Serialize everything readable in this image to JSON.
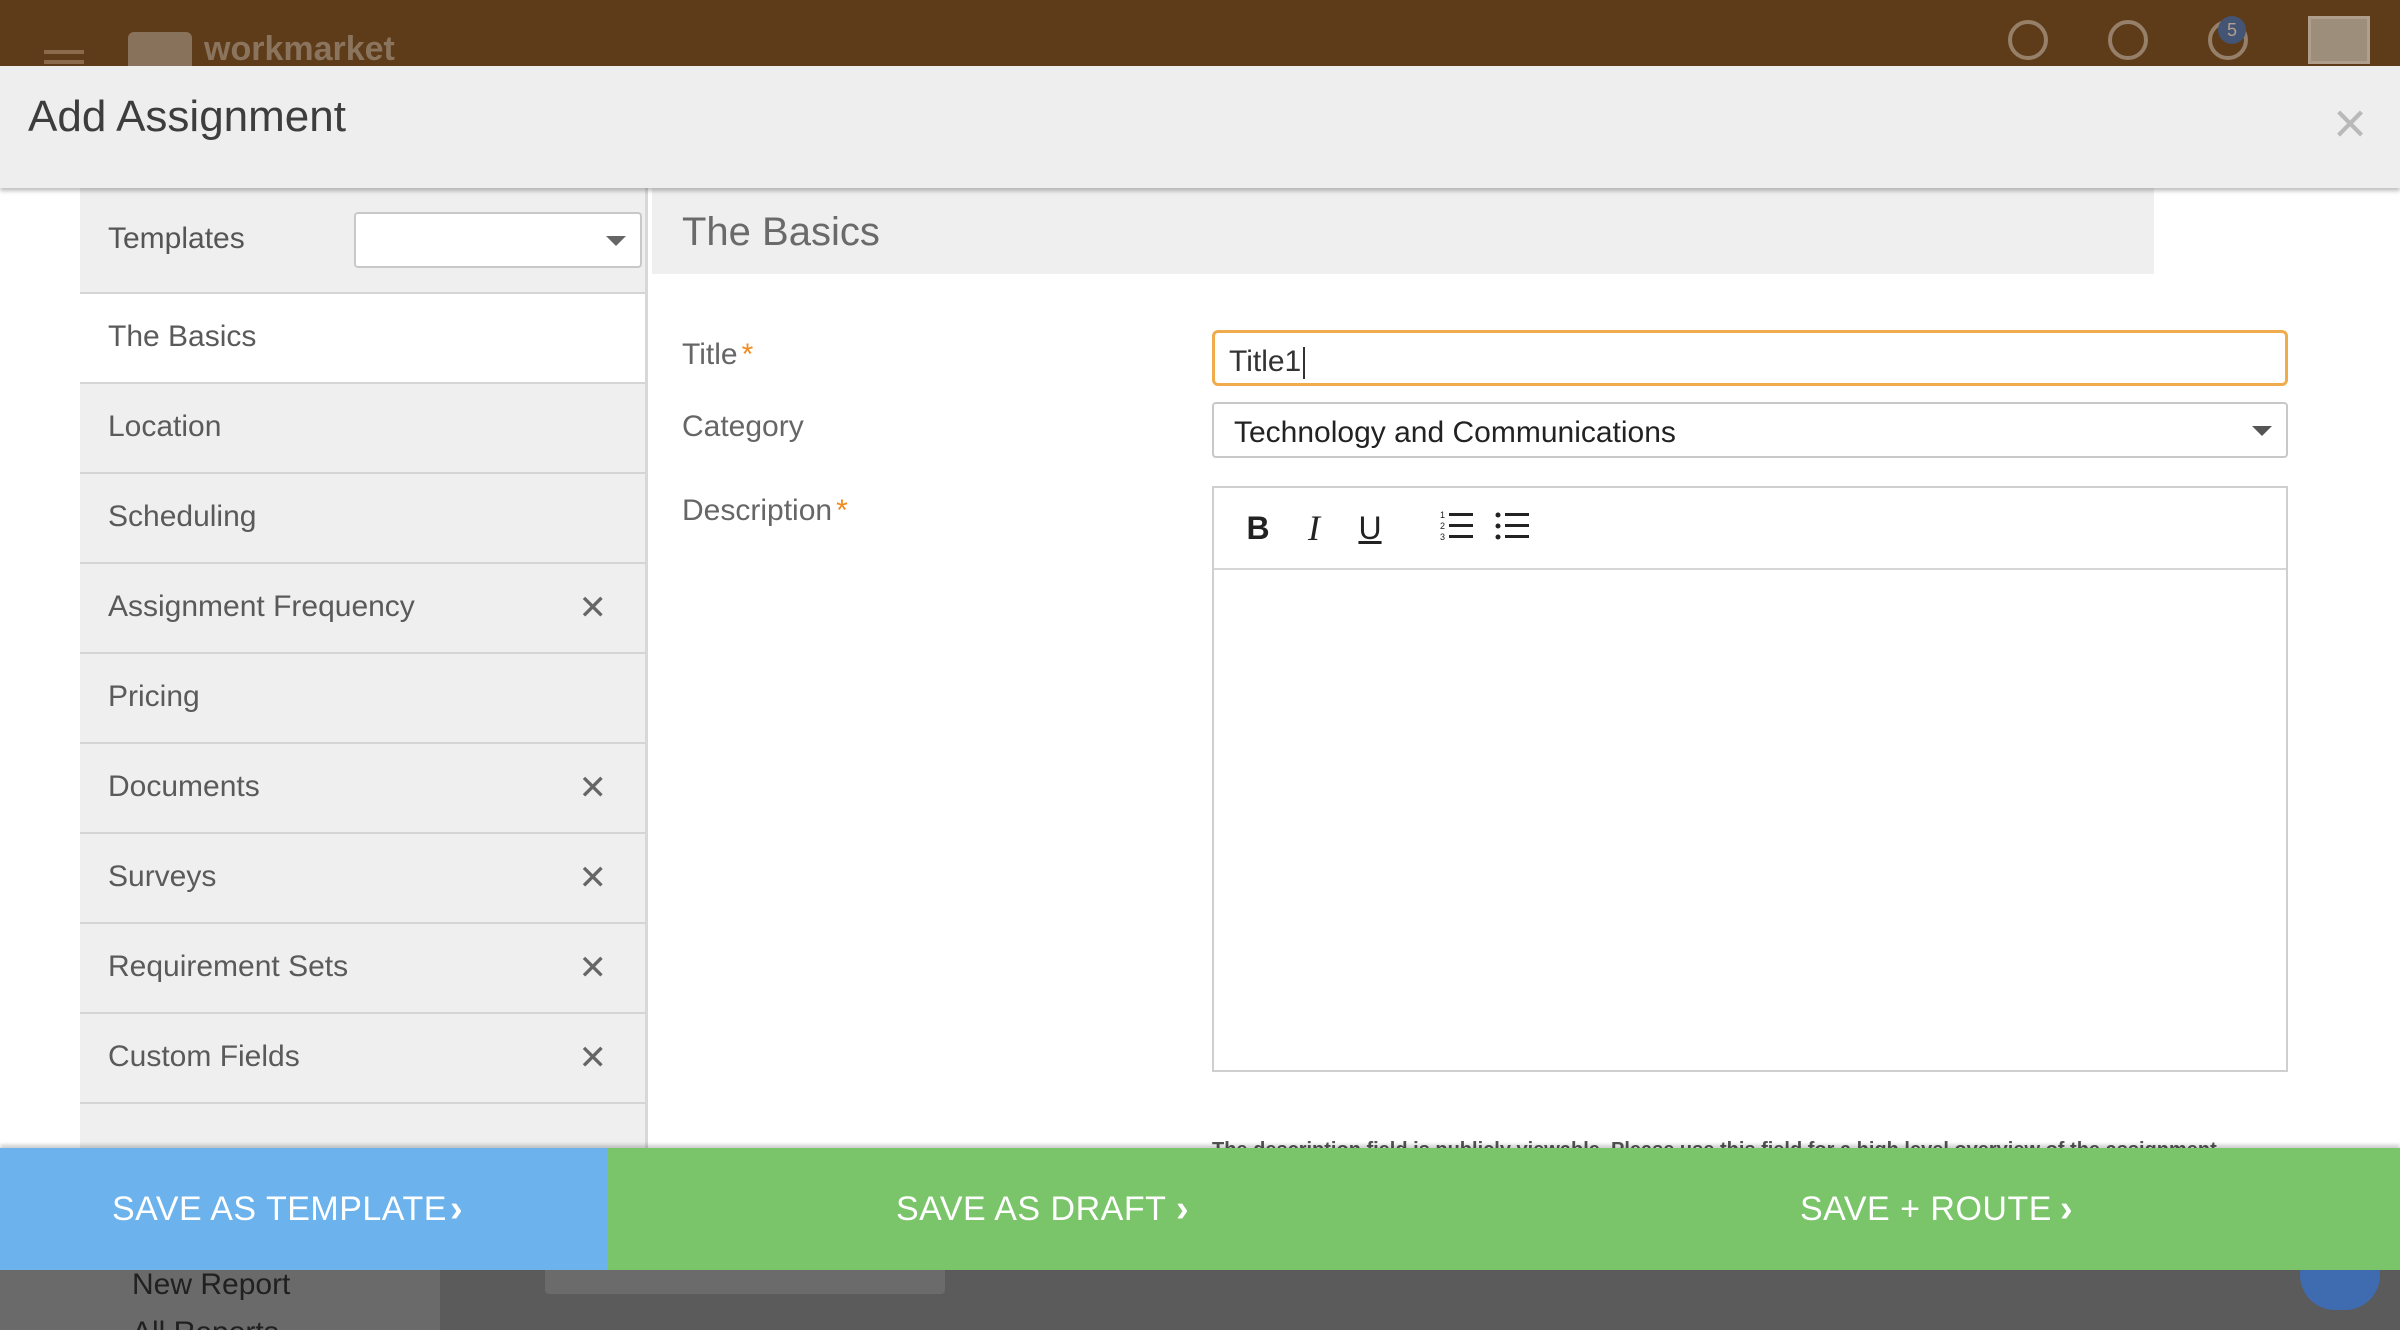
{
  "background": {
    "brand": "workmarket",
    "notification_badge": "5",
    "nav_items": [
      "New Report",
      "All Reports"
    ]
  },
  "modal": {
    "title": "Add Assignment",
    "close_icon": "close-icon"
  },
  "sidebar": {
    "templates_label": "Templates",
    "templates_value": "",
    "items": [
      {
        "label": "The Basics",
        "active": true,
        "removable": false
      },
      {
        "label": "Location",
        "removable": false
      },
      {
        "label": "Scheduling",
        "removable": false
      },
      {
        "label": "Assignment Frequency",
        "removable": true
      },
      {
        "label": "Pricing",
        "removable": false
      },
      {
        "label": "Documents",
        "removable": true
      },
      {
        "label": "Surveys",
        "removable": true
      },
      {
        "label": "Requirement Sets",
        "removable": true
      },
      {
        "label": "Custom Fields",
        "removable": true
      }
    ]
  },
  "main": {
    "section_title": "The Basics",
    "title_label": "Title",
    "title_value": "Title1",
    "category_label": "Category",
    "category_value": "Technology and Communications",
    "description_label": "Description",
    "required_mark": "*",
    "toolbar": {
      "bold": "B",
      "italic": "I",
      "underline": "U"
    },
    "help_text": "The description field is publicly viewable. Please use this field for a high level overview of the assignment details."
  },
  "footer": {
    "save_template": "SAVE AS TEMPLATE",
    "save_draft": "SAVE AS DRAFT",
    "save_route": "SAVE + ROUTE",
    "colors": {
      "template": "#6cb2ec",
      "green": "#7ac569"
    }
  }
}
